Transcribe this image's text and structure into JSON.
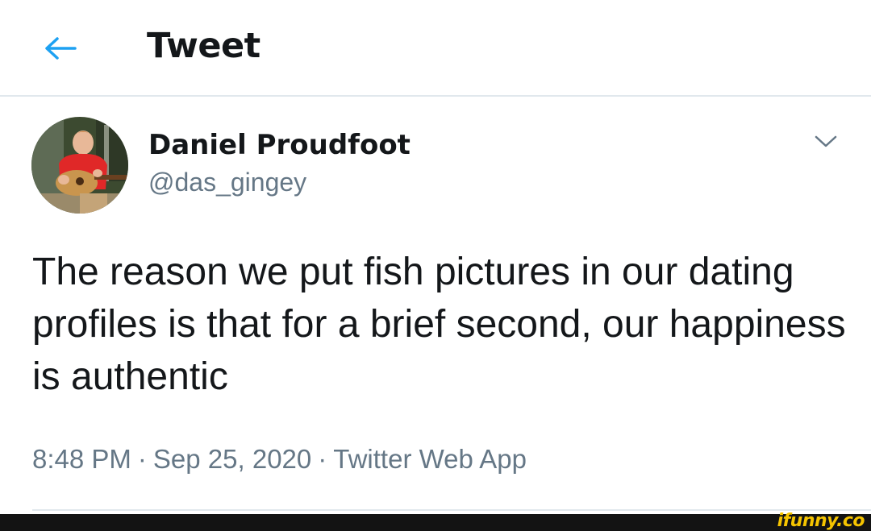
{
  "header": {
    "back_icon": "arrow-left-icon",
    "title": "Tweet"
  },
  "author": {
    "display_name": "Daniel Proudfoot",
    "handle": "@das_gingey",
    "avatar_icon": "avatar-photo"
  },
  "tweet": {
    "text": "The reason we put fish pictures in our dating profiles is that for a brief second, our happiness is authentic",
    "time": "8:48 PM",
    "date": "Sep 25, 2020",
    "source": "Twitter Web App",
    "separator": "·"
  },
  "watermark": {
    "text": "ifunny.co"
  },
  "colors": {
    "accent": "#1da1f2",
    "secondary_text": "#657786",
    "divider": "#e1e8ed",
    "watermark": "#f5c400"
  }
}
